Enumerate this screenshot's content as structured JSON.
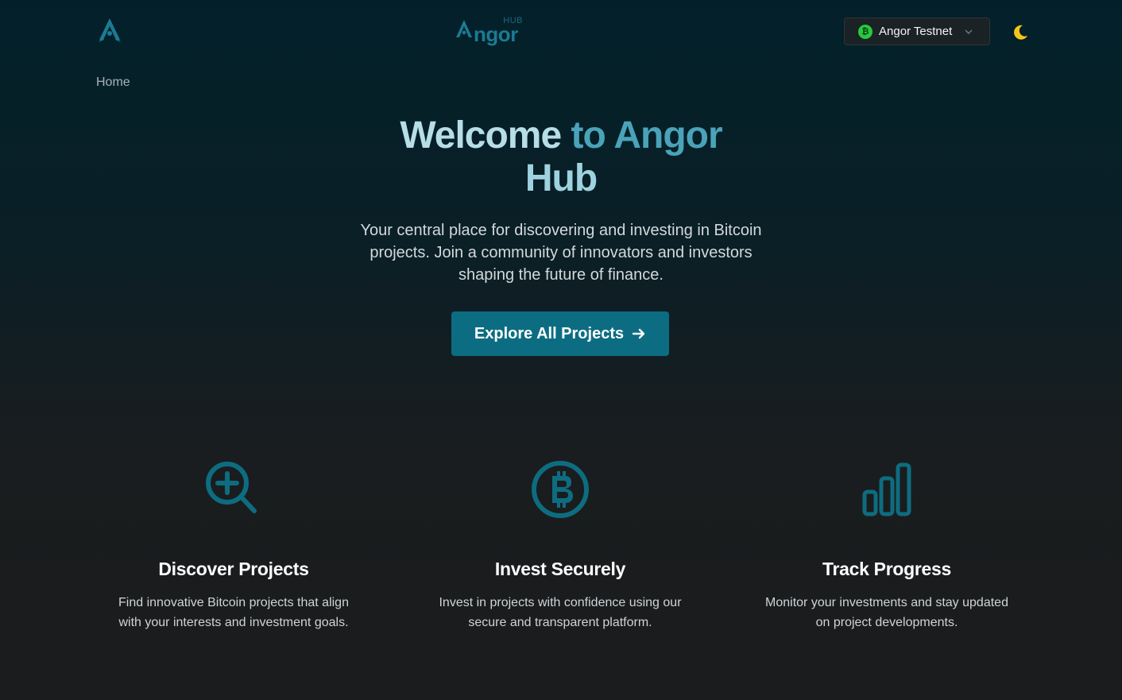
{
  "header": {
    "logo_hub": "HUB",
    "logo_word": "ngor",
    "network": {
      "label": "Angor Testnet",
      "icon": "bitcoin-icon",
      "status_color": "#27c93f"
    },
    "theme_icon": "moon-icon"
  },
  "breadcrumb": {
    "home": "Home"
  },
  "hero": {
    "title_part1": "Welcome",
    "title_part2": "to Angor",
    "title_part3": "Hub",
    "subtitle": "Your central place for discovering and investing in Bitcoin projects. Join a community of innovators and investors shaping the future of finance.",
    "cta_label": "Explore All Projects"
  },
  "features": [
    {
      "icon": "search-plus-icon",
      "title": "Discover Projects",
      "description": "Find innovative Bitcoin projects that align with your interests and investment goals."
    },
    {
      "icon": "bitcoin-icon",
      "title": "Invest Securely",
      "description": "Invest in projects with confidence using our secure and transparent platform."
    },
    {
      "icon": "bar-chart-icon",
      "title": "Track Progress",
      "description": "Monitor your investments and stay updated on project developments."
    }
  ],
  "colors": {
    "accent": "#0c6d82",
    "icon": "#0e6c80",
    "title_light": "#b7dde6",
    "title_mid": "#4aa3b8"
  }
}
